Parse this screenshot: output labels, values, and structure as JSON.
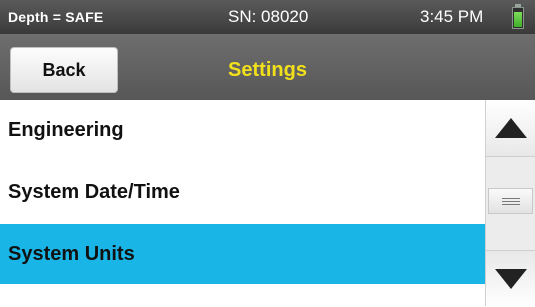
{
  "status_bar": {
    "depth_status": "Depth = SAFE",
    "serial_number": "SN: 08020",
    "time": "3:45 PM",
    "battery_icon": "battery-icon",
    "battery_level_fraction": 0.85,
    "battery_color": "#4fc23a"
  },
  "header": {
    "back_label": "Back",
    "title": "Settings",
    "title_color": "#f2e01a"
  },
  "settings_list": {
    "items": [
      {
        "label": "Engineering",
        "selected": false
      },
      {
        "label": "System Date/Time",
        "selected": false
      },
      {
        "label": "System Units",
        "selected": true
      }
    ],
    "selection_color": "#19b5e6"
  },
  "scrollbar": {
    "up_icon": "triangle-up-icon",
    "down_icon": "triangle-down-icon",
    "thumb_icon": "grip-lines-icon"
  }
}
